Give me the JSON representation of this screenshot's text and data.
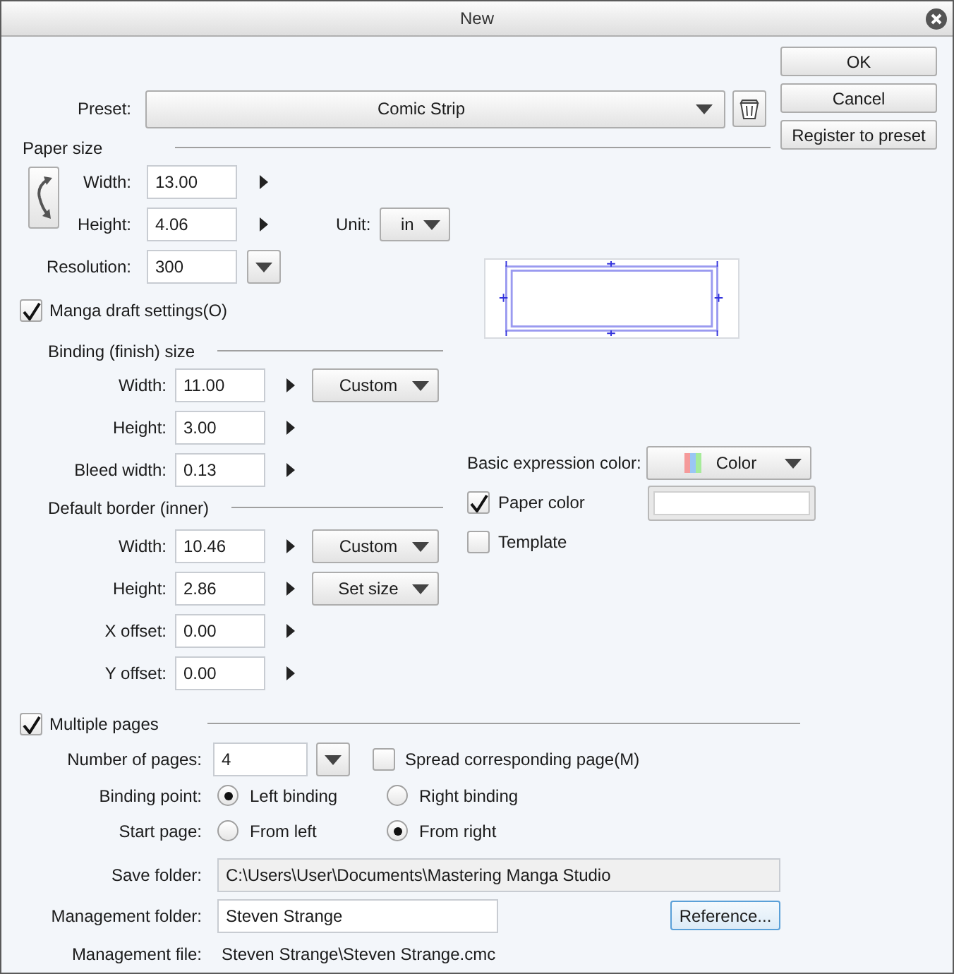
{
  "window": {
    "title": "New"
  },
  "buttons": [
    {
      "label": "OK"
    },
    {
      "label": "Cancel"
    },
    {
      "label": "Register to preset"
    }
  ],
  "preset": {
    "label": "Preset:",
    "value": "Comic Strip"
  },
  "paper_size": {
    "heading": "Paper size",
    "width": {
      "label": "Width:",
      "value": "13.00"
    },
    "height": {
      "label": "Height:",
      "value": "4.06"
    },
    "unit": {
      "label": "Unit:",
      "value": "in"
    },
    "resolution": {
      "label": "Resolution:",
      "value": "300"
    }
  },
  "manga_draft": {
    "label": "Manga draft settings(O)",
    "checked": true
  },
  "binding_size": {
    "heading": "Binding (finish) size",
    "fields": [
      {
        "label": "Width:",
        "value": "11.00",
        "dropdown": "Custom"
      },
      {
        "label": "Height:",
        "value": "3.00"
      },
      {
        "label": "Bleed width:",
        "value": "0.13"
      }
    ]
  },
  "default_border": {
    "heading": "Default border (inner)",
    "fields": [
      {
        "label": "Width:",
        "value": "10.46",
        "dropdown": "Custom"
      },
      {
        "label": "Height:",
        "value": "2.86",
        "dropdown": "Set size"
      },
      {
        "label": "X offset:",
        "value": "0.00"
      },
      {
        "label": "Y offset:",
        "value": "0.00"
      }
    ]
  },
  "expression_color": {
    "label": "Basic expression color:",
    "value": "Color"
  },
  "paper_color": {
    "label": "Paper color",
    "checked": true
  },
  "template": {
    "label": "Template",
    "checked": false
  },
  "multiple_pages": {
    "label": "Multiple pages",
    "checked": true
  },
  "number_of_pages": {
    "label": "Number of pages:",
    "value": "4"
  },
  "spread": {
    "label": "Spread corresponding page(M)",
    "checked": false
  },
  "binding_point": {
    "label": "Binding point:",
    "options": [
      {
        "label": "Left binding",
        "selected": true
      },
      {
        "label": "Right binding",
        "selected": false
      }
    ]
  },
  "start_page": {
    "label": "Start page:",
    "options": [
      {
        "label": "From left",
        "selected": false
      },
      {
        "label": "From right",
        "selected": true
      }
    ]
  },
  "save_folder": {
    "label": "Save folder:",
    "value": "C:\\Users\\User\\Documents\\Mastering Manga Studio"
  },
  "management_folder": {
    "label": "Management folder:",
    "value": "Steven Strange",
    "button": "Reference..."
  },
  "management_file": {
    "label": "Management file:",
    "value": "Steven Strange\\Steven Strange.cmc"
  }
}
